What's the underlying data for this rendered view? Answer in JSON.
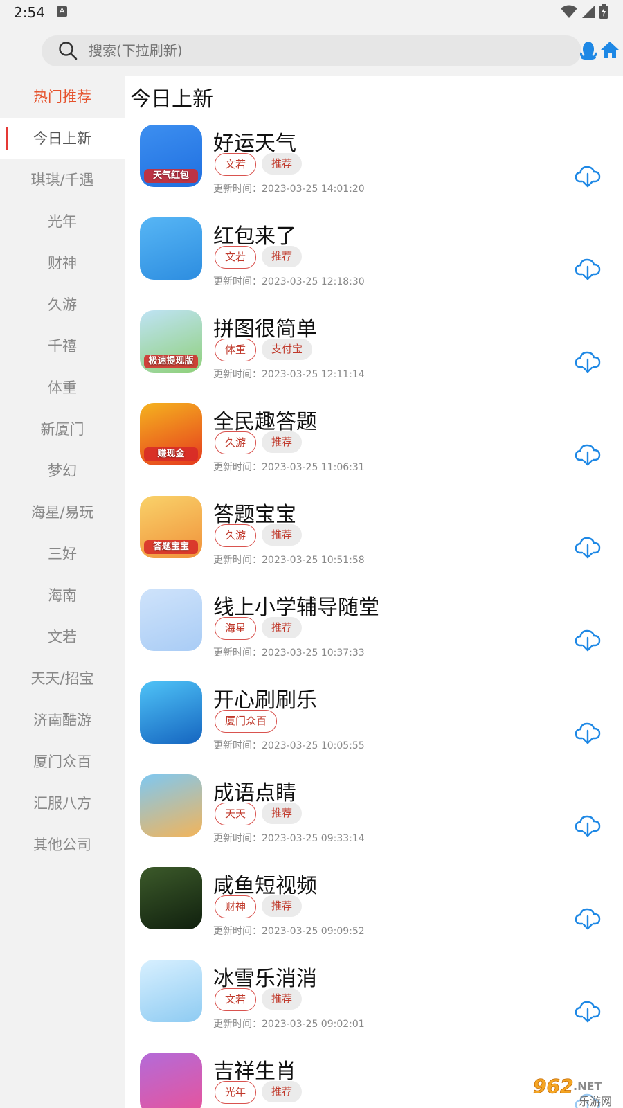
{
  "status_bar": {
    "time": "2:54",
    "notification_icon_letter": "A"
  },
  "search": {
    "placeholder": "搜索(下拉刷新)"
  },
  "sidebar": {
    "items": [
      {
        "label": "热门推荐",
        "state": "hot"
      },
      {
        "label": "今日上新",
        "state": "active"
      },
      {
        "label": "琪琪/千遇",
        "state": ""
      },
      {
        "label": "光年",
        "state": ""
      },
      {
        "label": "财神",
        "state": ""
      },
      {
        "label": "久游",
        "state": ""
      },
      {
        "label": "千禧",
        "state": ""
      },
      {
        "label": "体重",
        "state": ""
      },
      {
        "label": "新厦门",
        "state": ""
      },
      {
        "label": "梦幻",
        "state": ""
      },
      {
        "label": "海星/易玩",
        "state": ""
      },
      {
        "label": "三好",
        "state": ""
      },
      {
        "label": "海南",
        "state": ""
      },
      {
        "label": "文若",
        "state": ""
      },
      {
        "label": "天天/招宝",
        "state": ""
      },
      {
        "label": "济南酷游",
        "state": ""
      },
      {
        "label": "厦门众百",
        "state": ""
      },
      {
        "label": "汇服八方",
        "state": ""
      },
      {
        "label": "其他公司",
        "state": ""
      }
    ]
  },
  "main": {
    "title": "今日上新",
    "update_prefix": "更新时间：",
    "apps": [
      {
        "name": "好运天气",
        "company": "文若",
        "tag": "推荐",
        "updated": "2023-03-25 14:01:20",
        "icon_text": "天气红包",
        "colors": [
          "#3d8ff0",
          "#1f6fe0"
        ]
      },
      {
        "name": "红包来了",
        "company": "文若",
        "tag": "推荐",
        "updated": "2023-03-25 12:18:30",
        "icon_text": "",
        "colors": [
          "#57b6f5",
          "#2d8de0"
        ]
      },
      {
        "name": "拼图很简单",
        "company": "体重",
        "tag": "支付宝",
        "updated": "2023-03-25 12:11:14",
        "icon_text": "极速提现版",
        "colors": [
          "#bfe3f5",
          "#8fd07a"
        ]
      },
      {
        "name": "全民趣答题",
        "company": "久游",
        "tag": "推荐",
        "updated": "2023-03-25 11:06:31",
        "icon_text": "赚现金",
        "colors": [
          "#f5b31f",
          "#e53a1e"
        ]
      },
      {
        "name": "答题宝宝",
        "company": "久游",
        "tag": "推荐",
        "updated": "2023-03-25 10:51:58",
        "icon_text": "答题宝宝",
        "colors": [
          "#f9d26a",
          "#f0913a"
        ]
      },
      {
        "name": "线上小学辅导随堂",
        "company": "海星",
        "tag": "推荐",
        "updated": "2023-03-25 10:37:33",
        "icon_text": "",
        "colors": [
          "#cfe3fb",
          "#a9ccf5"
        ]
      },
      {
        "name": "开心刷刷乐",
        "company": "厦门众百",
        "tag": "",
        "updated": "2023-03-25 10:05:55",
        "icon_text": "",
        "colors": [
          "#4fc3f7",
          "#1565c0"
        ]
      },
      {
        "name": "成语点睛",
        "company": "天天",
        "tag": "推荐",
        "updated": "2023-03-25 09:33:14",
        "icon_text": "",
        "colors": [
          "#7ec8f2",
          "#f2b45a"
        ]
      },
      {
        "name": "咸鱼短视频",
        "company": "财神",
        "tag": "推荐",
        "updated": "2023-03-25 09:09:52",
        "icon_text": "",
        "colors": [
          "#3c5a2a",
          "#10200e"
        ]
      },
      {
        "name": "冰雪乐消消",
        "company": "文若",
        "tag": "推荐",
        "updated": "2023-03-25 09:02:01",
        "icon_text": "",
        "colors": [
          "#d8f0ff",
          "#8ecbf2"
        ]
      },
      {
        "name": "吉祥生肖",
        "company": "光年",
        "tag": "推荐",
        "updated": "",
        "icon_text": "",
        "colors": [
          "#b36bd9",
          "#e8539a"
        ]
      }
    ]
  },
  "watermark": {
    "text": "962",
    "suffix": ".NET",
    "subtext": "乐游网"
  },
  "colors": {
    "accent_red": "#e5522c",
    "download_blue": "#1e88e5",
    "active_indicator": "#e53935"
  },
  "icons": [
    "search-icon",
    "qq-penguin-icon",
    "home-icon",
    "cloud-download-icon",
    "wifi-icon",
    "signal-icon",
    "battery-icon"
  ]
}
